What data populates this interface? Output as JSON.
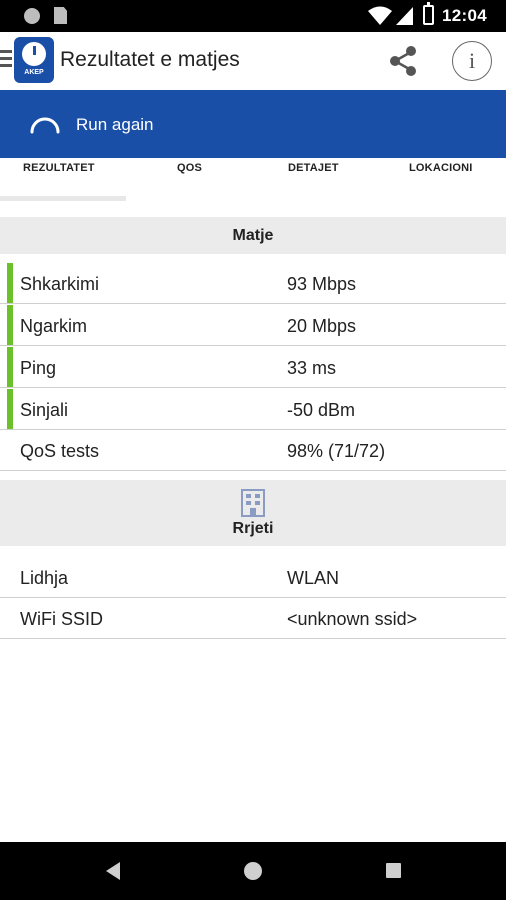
{
  "status_bar": {
    "time": "12:04"
  },
  "toolbar": {
    "title": "Rezultatet e matjes",
    "logo_text": "AKEP",
    "menu_icon": "hamburger-icon",
    "share_icon": "share-icon",
    "info_icon": "info-icon",
    "info_glyph": "i"
  },
  "run_bar": {
    "label": "Run again",
    "icon": "loading-spinner-icon",
    "background": "#1a4fa8"
  },
  "tabs": [
    {
      "label": "REZULTATET",
      "selected": true
    },
    {
      "label": "QOS",
      "selected": false
    },
    {
      "label": "DETAJET",
      "selected": false
    },
    {
      "label": "LOKACIONI",
      "selected": false
    }
  ],
  "sections": {
    "measurements": {
      "title": "Matje",
      "rows": [
        {
          "label": "Shkarkimi",
          "value": "93 Mbps",
          "indicator": "#6cc02b"
        },
        {
          "label": "Ngarkim",
          "value": "20 Mbps",
          "indicator": "#6cc02b"
        },
        {
          "label": "Ping",
          "value": "33 ms",
          "indicator": "#6cc02b"
        },
        {
          "label": "Sinjali",
          "value": "-50 dBm",
          "indicator": "#6cc02b"
        },
        {
          "label": "QoS tests",
          "value": "98% (71/72)"
        }
      ]
    },
    "network": {
      "title": "Rrjeti",
      "icon": "building-icon",
      "rows": [
        {
          "label": "Lidhja",
          "value": "WLAN"
        },
        {
          "label": "WiFi SSID",
          "value": "<unknown ssid>"
        }
      ]
    }
  },
  "nav_bar": {
    "back": "back-icon",
    "home": "home-icon",
    "recent": "recent-apps-icon"
  }
}
